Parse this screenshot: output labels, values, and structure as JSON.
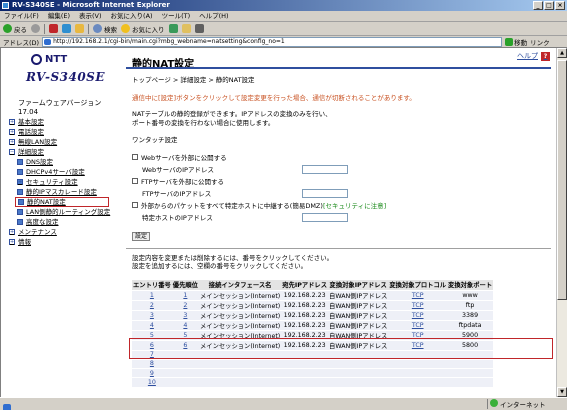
{
  "window": {
    "title": "RV-S340SE - Microsoft Internet Explorer"
  },
  "menu": {
    "items": [
      "ファイル(F)",
      "編集(E)",
      "表示(V)",
      "お気に入り(A)",
      "ツール(T)",
      "ヘルプ(H)"
    ]
  },
  "toolbar": {
    "back": "戻る",
    "search": "検索",
    "favorites": "お気に入り"
  },
  "address": {
    "label": "アドレス(D)",
    "url": "http://192.168.2.1/cgi-bin/main.cgi?mbg_webname=natsetting&config_no=1",
    "go_label": "移動",
    "links_label": "リンク"
  },
  "sidebar": {
    "brand": "NTT",
    "model": "RV-S340SE",
    "firmware": "ファームウェアバージョン 17.04",
    "nav": [
      {
        "label": "基本設定",
        "level": 0,
        "mark": "+"
      },
      {
        "label": "電話設定",
        "level": 0,
        "mark": "+"
      },
      {
        "label": "無線LAN設定",
        "level": 0,
        "mark": "+"
      },
      {
        "label": "詳細設定",
        "level": 0,
        "mark": "−"
      },
      {
        "label": "DNS設定",
        "level": 1,
        "mark": ""
      },
      {
        "label": "DHCPv4サーバ設定",
        "level": 1,
        "mark": ""
      },
      {
        "label": "セキュリティ設定",
        "level": 1,
        "mark": "+"
      },
      {
        "label": "静的IPマスカレード設定",
        "level": 1,
        "mark": ""
      },
      {
        "label": "静的NAT設定",
        "level": 1,
        "mark": "",
        "current": true
      },
      {
        "label": "LAN側静的ルーティング設定",
        "level": 1,
        "mark": ""
      },
      {
        "label": "高度な設定",
        "level": 1,
        "mark": ""
      },
      {
        "label": "メンテナンス",
        "level": 0,
        "mark": "+"
      },
      {
        "label": "情報",
        "level": 0,
        "mark": "+"
      }
    ]
  },
  "main": {
    "help_label": "ヘルプ",
    "help_mark": "?",
    "title": "静的NAT設定",
    "breadcrumb": [
      "トップページ",
      "詳細設定",
      "静的NAT設定"
    ],
    "breadcrumb_sep": ">",
    "notice": "通信中に[設定]ボタンをクリックして設定変更を行った場合、通信が切断されることがあります。",
    "desc_line1": "NATテーブルの静的登録ができます。IPアドレスの変換のみを行い、",
    "desc_line2": "ポート番号の変換を行わない場合に使用します。",
    "one_touch_label": "ワンタッチ設定",
    "web_publish": "Webサーバを外部に公開する",
    "web_ip_label": "WebサーバのIPアドレス",
    "ftp_publish": "FTPサーバを外部に公開する",
    "ftp_ip_label": "FTPサーバのIPアドレス",
    "dmz_publish": "外部からのパケットをすべて特定ホストに中継する(簡易DMZ)",
    "dmz_link": "[セキュリティに注意]",
    "dmz_ip_label": "特定ホストのIPアドレス",
    "apply_button": "設定",
    "table_note1": "設定内容を変更または削除するには、番号をクリックしてください。",
    "table_note2": "設定を追加するには、空欄の番号をクリックしてください。"
  },
  "nat_table": {
    "headers": [
      "エントリ番号",
      "優先順位",
      "接続インタフェース名",
      "宛先IPアドレス",
      "変換対象IPアドレス",
      "変換対象プロトコル",
      "変換対象ポート"
    ],
    "rows": [
      [
        "1",
        "1",
        "メインセッション(Internet)",
        "192.168.2.23",
        "自WAN側IPアドレス",
        "TCP",
        "www"
      ],
      [
        "2",
        "2",
        "メインセッション(Internet)",
        "192.168.2.23",
        "自WAN側IPアドレス",
        "TCP",
        "ftp"
      ],
      [
        "3",
        "3",
        "メインセッション(Internet)",
        "192.168.2.23",
        "自WAN側IPアドレス",
        "TCP",
        "3389"
      ],
      [
        "4",
        "4",
        "メインセッション(Internet)",
        "192.168.2.23",
        "自WAN側IPアドレス",
        "TCP",
        "ftpdata"
      ],
      [
        "5",
        "5",
        "メインセッション(Internet)",
        "192.168.2.23",
        "自WAN側IPアドレス",
        "TCP",
        "5900"
      ],
      [
        "6",
        "6",
        "メインセッション(Internet)",
        "192.168.2.23",
        "自WAN側IPアドレス",
        "TCP",
        "5800"
      ],
      [
        "7",
        "",
        "",
        "",
        "",
        "",
        ""
      ],
      [
        "8",
        "",
        "",
        "",
        "",
        "",
        ""
      ],
      [
        "9",
        "",
        "",
        "",
        "",
        "",
        ""
      ],
      [
        "10",
        "",
        "",
        "",
        "",
        "",
        ""
      ]
    ]
  },
  "statusbar": {
    "zone": "インターネット"
  }
}
